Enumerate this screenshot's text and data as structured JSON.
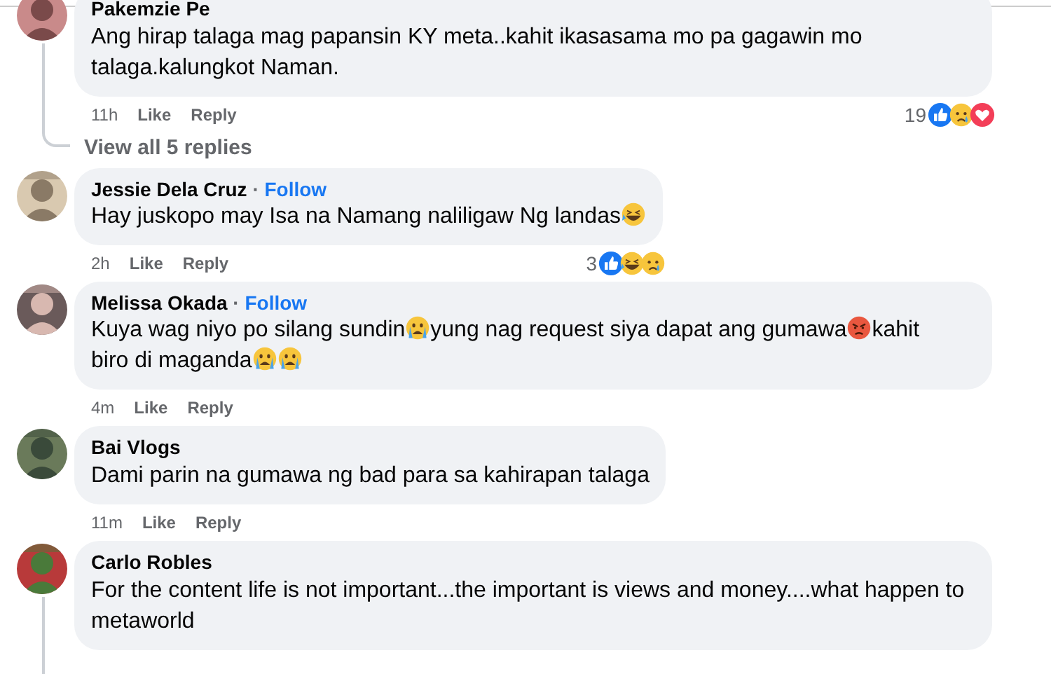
{
  "comments": [
    {
      "author": "Pakemzie Pe",
      "avatar": {
        "kind": "picture"
      },
      "body": [
        {
          "kind": "text",
          "text": "Ang hirap talaga mag papansin KY meta..kahit ikasasama mo pa gagawin mo talaga.kalungkot Naman."
        }
      ],
      "time": "11h",
      "like": "Like",
      "reply": "Reply",
      "reactions": {
        "count": "19",
        "icons": [
          {
            "kind": "like"
          },
          {
            "kind": "sad"
          },
          {
            "kind": "love"
          }
        ]
      },
      "replies_link": "View all 5 replies"
    },
    {
      "author": "Jessie Dela Cruz",
      "separator": "·",
      "follow": "Follow",
      "avatar": {
        "kind": "picture"
      },
      "body": [
        {
          "kind": "text",
          "text": "Hay juskopo may Isa na Namang naliligaw Ng landas"
        },
        {
          "kind": "laughing"
        }
      ],
      "time": "2h",
      "like": "Like",
      "reply": "Reply",
      "reactions": {
        "count": "3",
        "icons": [
          {
            "kind": "like"
          },
          {
            "kind": "laughing"
          },
          {
            "kind": "sad"
          }
        ]
      }
    },
    {
      "author": "Melissa Okada",
      "separator": "·",
      "follow": "Follow",
      "avatar": {
        "kind": "picture"
      },
      "body": [
        {
          "kind": "text",
          "text": "Kuya wag niyo po silang sundin"
        },
        {
          "kind": "crying"
        },
        {
          "kind": "text",
          "text": "yung nag request siya dapat ang gumawa"
        },
        {
          "kind": "angry"
        },
        {
          "kind": "text",
          "text": "kahit"
        },
        {
          "kind": "text",
          "text": "biro di maganda"
        },
        {
          "kind": "crying"
        },
        {
          "kind": "crying"
        }
      ],
      "time": "4m",
      "like": "Like",
      "reply": "Reply"
    },
    {
      "author": "Bai Vlogs",
      "avatar": {
        "kind": "picture"
      },
      "body": [
        {
          "kind": "text",
          "text": "Dami parin na gumawa ng bad para sa kahirapan talaga"
        }
      ],
      "time": "11m",
      "like": "Like",
      "reply": "Reply"
    },
    {
      "author": "Carlo Robles",
      "avatar": {
        "kind": "picture"
      },
      "body": [
        {
          "kind": "text",
          "text": "For the content life is not important...the important is views and money....what happen to metaworld"
        }
      ],
      "thread_below": true
    }
  ]
}
